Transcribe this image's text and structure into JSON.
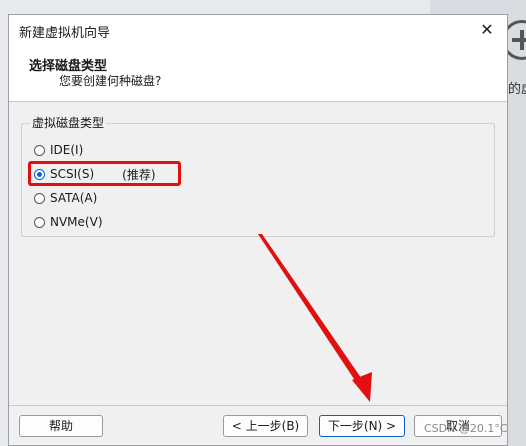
{
  "background": {
    "partial_label": "的虚"
  },
  "dialog": {
    "title": "新建虚拟机向导",
    "close_glyph": "✕",
    "header": {
      "title": "选择磁盘类型",
      "subtitle": "您要创建何种磁盘?"
    },
    "group_label": "虚拟磁盘类型",
    "options": [
      {
        "label": "IDE(I)",
        "checked": false
      },
      {
        "label": "SCSI(S)",
        "checked": true,
        "note": "(推荐)"
      },
      {
        "label": "SATA(A)",
        "checked": false
      },
      {
        "label": "NVMe(V)",
        "checked": false
      }
    ],
    "buttons": {
      "help": "帮助",
      "back": "< 上一步(B)",
      "next": "下一步(N) >",
      "cancel": "取消"
    }
  },
  "watermark": "CSDN @20.1°C",
  "colors": {
    "highlight_box": "#e01010",
    "annotation_arrow": "#e01010",
    "radio_checked": "#0a64c8"
  }
}
